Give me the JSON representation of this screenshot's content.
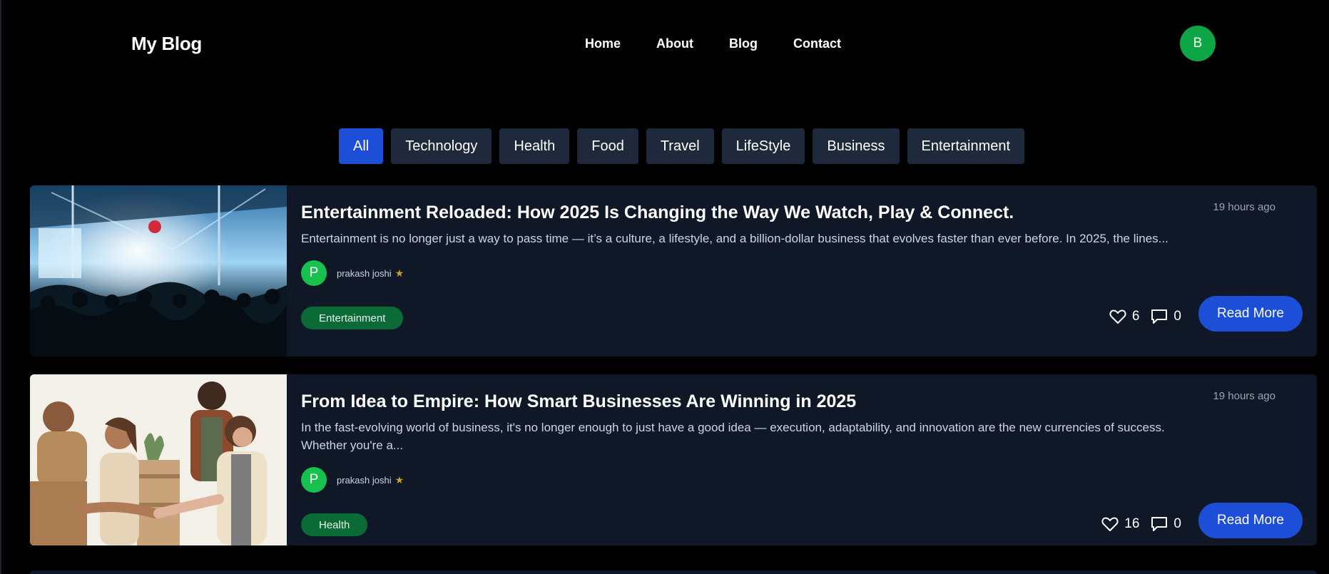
{
  "header": {
    "logo": "My Blog",
    "nav": [
      "Home",
      "About",
      "Blog",
      "Contact"
    ],
    "user_initial": "B"
  },
  "categories": {
    "items": [
      "All",
      "Technology",
      "Health",
      "Food",
      "Travel",
      "LifeStyle",
      "Business",
      "Entertainment"
    ],
    "active": "All"
  },
  "posts": [
    {
      "title": "Entertainment Reloaded: How 2025 Is Changing the Way We Watch, Play & Connect.",
      "time": "19 hours ago",
      "excerpt": "Entertainment is no longer just a way to pass time — it’s a culture, a lifestyle, and a billion-dollar business that evolves faster than ever before. In 2025, the lines...",
      "author_initial": "P",
      "author_name": "prakash joshi",
      "tag": "Entertainment",
      "likes": "6",
      "comments": "0",
      "read_more": "Read More"
    },
    {
      "title": "From Idea to Empire: How Smart Businesses Are Winning in 2025",
      "time": "19 hours ago",
      "excerpt": "In the fast-evolving world of business, it's no longer enough to just have a good idea — execution, adaptability, and innovation are the new currencies of success. Whether you're a...",
      "author_initial": "P",
      "author_name": "prakash joshi",
      "tag": "Health",
      "likes": "16",
      "comments": "0",
      "read_more": "Read More"
    }
  ],
  "colors": {
    "accent": "#1d4ed8",
    "card_bg": "#101828",
    "chip_bg": "#1e293b",
    "tag_bg": "#0a6b36",
    "avatar_green": "#16c24d"
  }
}
